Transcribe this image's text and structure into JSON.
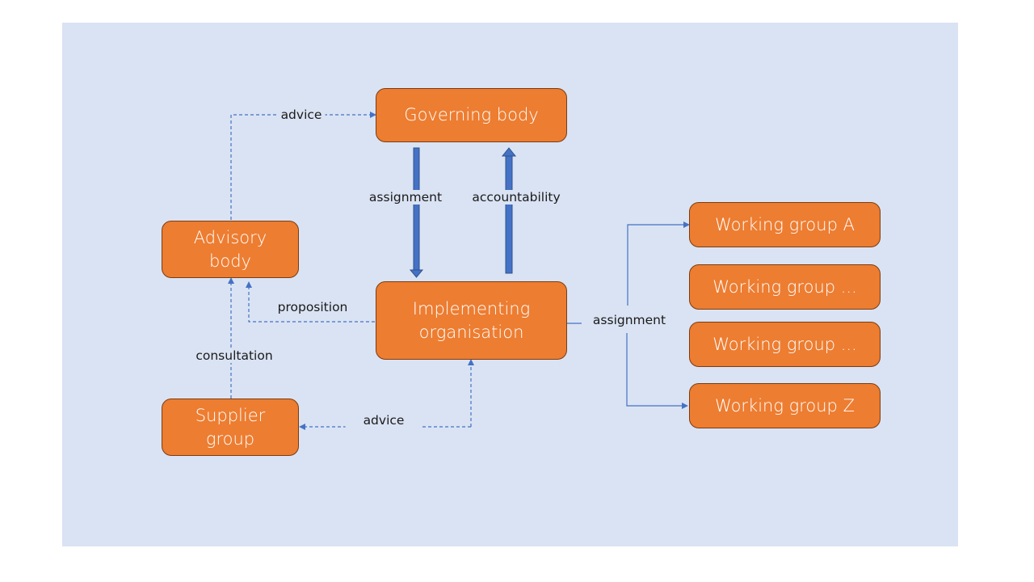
{
  "diagram": {
    "colors": {
      "background": "#dae3f3",
      "node_fill": "#ed7d31",
      "node_border": "#7a3c12",
      "node_text": "#ffffff",
      "connector": "#4472c4"
    },
    "nodes": {
      "governing_body": "Governing body",
      "advisory_body": "Advisory\nbody",
      "implementing_organisation": "Implementing\norganisation",
      "supplier_group": "Supplier\ngroup",
      "working_group_a": "Working group A",
      "working_group_2": "Working group ...",
      "working_group_3": "Working group ...",
      "working_group_z": "Working group Z"
    },
    "edges": [
      {
        "from": "advisory_body",
        "to": "governing_body",
        "label": "advice",
        "style": "dashed"
      },
      {
        "from": "governing_body",
        "to": "implementing_organisation",
        "label": "assignment",
        "style": "block-arrow"
      },
      {
        "from": "implementing_organisation",
        "to": "governing_body",
        "label": "accountability",
        "style": "block-arrow"
      },
      {
        "from": "implementing_organisation",
        "to": "advisory_body",
        "label": "proposition",
        "style": "dashed"
      },
      {
        "from": "supplier_group",
        "to": "advisory_body",
        "label": "consultation",
        "style": "dashed"
      },
      {
        "from": "implementing_organisation",
        "to": "supplier_group",
        "label": "advice",
        "style": "dashed"
      },
      {
        "from": "implementing_organisation",
        "to": "working_group_a",
        "label": "assignment",
        "style": "solid"
      },
      {
        "from": "implementing_organisation",
        "to": "working_group_z",
        "label": "",
        "style": "solid"
      }
    ],
    "labels": {
      "advice_top": "advice",
      "assignment_vertical": "assignment",
      "accountability": "accountability",
      "proposition": "proposition",
      "consultation": "consultation",
      "advice_bottom": "advice",
      "assignment_right": "assignment"
    }
  }
}
